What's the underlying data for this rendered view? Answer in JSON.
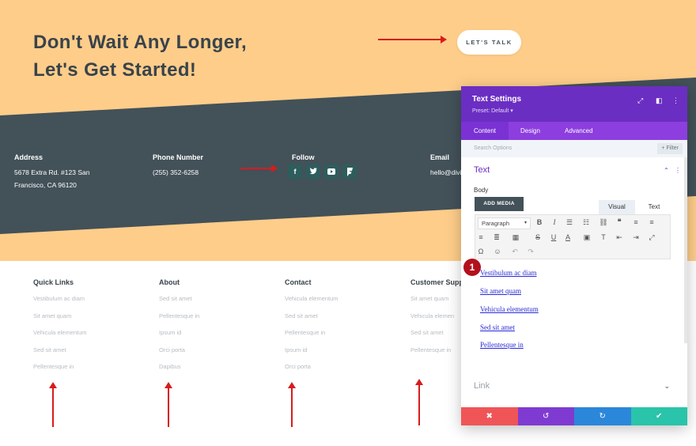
{
  "hero": {
    "headline_line1": "Don't Wait Any Longer,",
    "headline_line2": "Let's Get Started!",
    "cta_label": "LET'S TALK"
  },
  "contact_bar": {
    "address_heading": "Address",
    "address_line1": "5678 Extra Rd. #123 San",
    "address_line2": "Francisco, CA 96120",
    "phone_heading": "Phone Number",
    "phone_value": "(255) 352-6258",
    "follow_heading": "Follow",
    "social_icons": [
      "facebook-icon",
      "twitter-icon",
      "youtube-icon",
      "foursquare-icon"
    ],
    "email_heading": "Email",
    "email_value": "hello@divi"
  },
  "footer_links": [
    {
      "heading": "Quick Links",
      "links": [
        "Vestibulum ac diam",
        "Sit amet quam",
        "Vehicula elementum",
        "Sed sit amet",
        "Pellentesque in"
      ]
    },
    {
      "heading": "About",
      "links": [
        "Sed sit amet",
        "Pellentesque in",
        "Ipsum id",
        "Orci porta",
        "Dapibus"
      ]
    },
    {
      "heading": "Contact",
      "links": [
        "Vehicula elementum",
        "Sed sit amet",
        "Pellentesque in",
        "Ipsum id",
        "Orci porta"
      ]
    },
    {
      "heading": "Customer Suppo",
      "links": [
        "Sit amet quam",
        "Vehicula elemen",
        "Sed sit amet",
        "Pellentesque in"
      ]
    }
  ],
  "panel": {
    "title": "Text Settings",
    "preset": "Preset: Default ▾",
    "tabs": [
      "Content",
      "Design",
      "Advanced"
    ],
    "active_tab": "Content",
    "search_placeholder": "Search Options",
    "filter_label": "+ Filter",
    "section_text": "Text",
    "body_label": "Body",
    "add_media": "ADD MEDIA",
    "editor_tabs": [
      "Visual",
      "Text"
    ],
    "paragraph_select": "Paragraph",
    "editor_links": [
      "Vestibulum ac diam",
      "Sit amet quam",
      "Vehicula elementum",
      "Sed sit amet",
      "Pellentesque in"
    ],
    "step_badge": "1",
    "section_link": "Link"
  },
  "colors": {
    "hero_bg": "#fecd8a",
    "contact_bg": "#435159",
    "panel_header": "#6b2ec2",
    "panel_tabs": "#8d3ede",
    "arrow_red": "#d81b1b",
    "cancel": "#ef5557",
    "undo": "#7f3bd1",
    "redo": "#2b87da",
    "save": "#29c4a9"
  }
}
